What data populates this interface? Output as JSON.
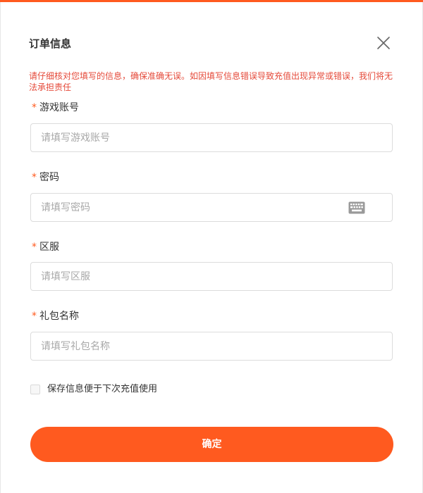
{
  "dialog": {
    "title": "订单信息",
    "close_icon": "close-icon",
    "warning": "请仔细核对您填写的信息，确保准确无误。如因填写信息错误导致充值出现异常或错误，我们将无法承担责任"
  },
  "fields": [
    {
      "required_mark": "*",
      "label": "游戏账号",
      "placeholder": "请填写游戏账号",
      "value": ""
    },
    {
      "required_mark": "*",
      "label": "密码",
      "placeholder": "请填写密码",
      "value": "",
      "icon": "keyboard-icon"
    },
    {
      "required_mark": "*",
      "label": "区服",
      "placeholder": "请填写区服",
      "value": ""
    },
    {
      "required_mark": "*",
      "label": "礼包名称",
      "placeholder": "请填写礼包名称",
      "value": ""
    }
  ],
  "remember": {
    "label": "保存信息便于下次充值使用",
    "checked": false
  },
  "confirm_button": {
    "label": "确定"
  },
  "colors": {
    "accent": "#ff5a1f",
    "warning_text": "#e54a3a",
    "required_mark": "#ff5a1f",
    "placeholder": "#a8a8a8",
    "border": "#dcdcdc"
  }
}
